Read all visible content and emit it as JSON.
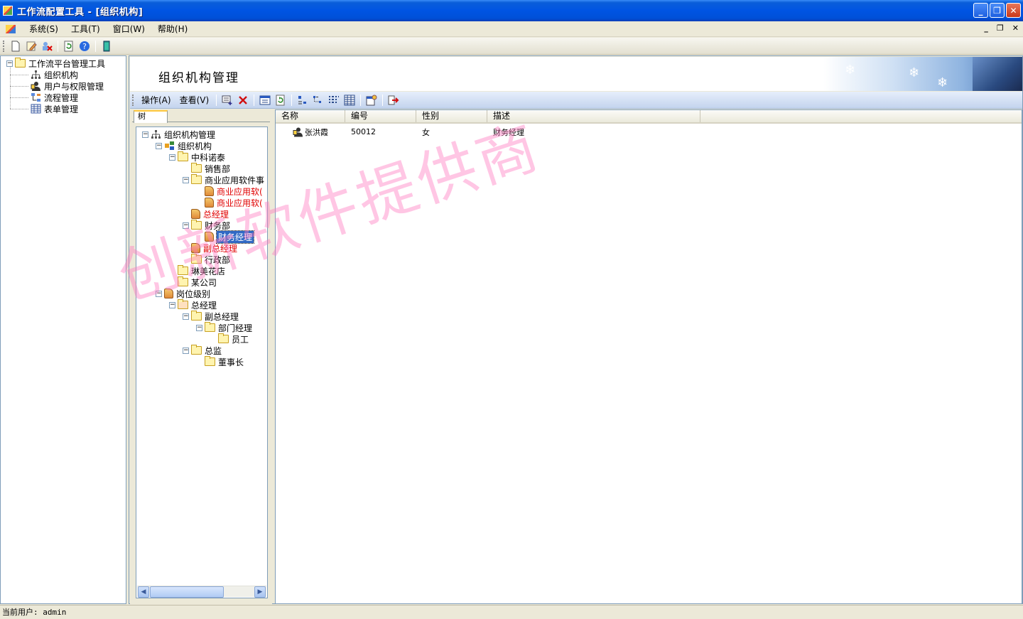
{
  "window": {
    "title": "工作流配置工具 - [组织机构]"
  },
  "menu": {
    "items": [
      "系统(S)",
      "工具(T)",
      "窗口(W)",
      "帮助(H)"
    ]
  },
  "toolbar_icons": [
    "new-icon",
    "edit-icon",
    "delete-user-icon",
    "refresh-icon",
    "help-icon",
    "exit-icon"
  ],
  "nav": {
    "root": "工作流平台管理工具",
    "items": [
      "组织机构",
      "用户与权限管理",
      "流程管理",
      "表单管理"
    ]
  },
  "child": {
    "title": "组织机构管理",
    "toolbar": {
      "operate": "操作(A)",
      "view": "查看(V)"
    },
    "tab_label": "树"
  },
  "org_tree": [
    {
      "label": "组织机构管理",
      "level": 0,
      "icon": "hierarchy-icon",
      "expanded": true
    },
    {
      "label": "组织机构",
      "level": 1,
      "icon": "org-icon",
      "expanded": true
    },
    {
      "label": "中科诺泰",
      "level": 2,
      "icon": "folder-icon",
      "expanded": true
    },
    {
      "label": "销售部",
      "level": 3,
      "icon": "folder-icon"
    },
    {
      "label": "商业应用软件事",
      "level": 3,
      "icon": "folder-icon",
      "expanded": true
    },
    {
      "label": "商业应用软(",
      "level": 4,
      "icon": "person-icon",
      "red": true
    },
    {
      "label": "商业应用软(",
      "level": 4,
      "icon": "person-icon",
      "red": true
    },
    {
      "label": "总经理",
      "level": 3,
      "icon": "person-icon",
      "red": true
    },
    {
      "label": "财务部",
      "level": 3,
      "icon": "folder-icon",
      "expanded": true
    },
    {
      "label": "财务经理",
      "level": 4,
      "icon": "person-icon",
      "selected": true
    },
    {
      "label": "副总经理",
      "level": 3,
      "icon": "person-icon",
      "red": true
    },
    {
      "label": "行政部",
      "level": 3,
      "icon": "folder-icon"
    },
    {
      "label": "琳美花店",
      "level": 2,
      "icon": "folder-icon"
    },
    {
      "label": "某公司",
      "level": 2,
      "icon": "folder-icon"
    },
    {
      "label": "岗位级别",
      "level": 1,
      "icon": "person-icon",
      "expanded": true
    },
    {
      "label": "总经理",
      "level": 2,
      "icon": "folder-icon",
      "expanded": true
    },
    {
      "label": "副总经理",
      "level": 3,
      "icon": "folder-icon",
      "expanded": true
    },
    {
      "label": "部门经理",
      "level": 4,
      "icon": "folder-icon",
      "expanded": true
    },
    {
      "label": "员工",
      "level": 5,
      "icon": "folder-icon"
    },
    {
      "label": "总监",
      "level": 3,
      "icon": "folder-icon",
      "expanded": true
    },
    {
      "label": "董事长",
      "level": 4,
      "icon": "folder-icon"
    }
  ],
  "list": {
    "columns": [
      "名称",
      "编号",
      "性别",
      "描述"
    ],
    "rows": [
      {
        "name": "张洪霞",
        "code": "50012",
        "gender": "女",
        "desc": "财务经理"
      }
    ]
  },
  "watermark": "创新软件提供商",
  "status": {
    "text": "当前用户: admin"
  }
}
